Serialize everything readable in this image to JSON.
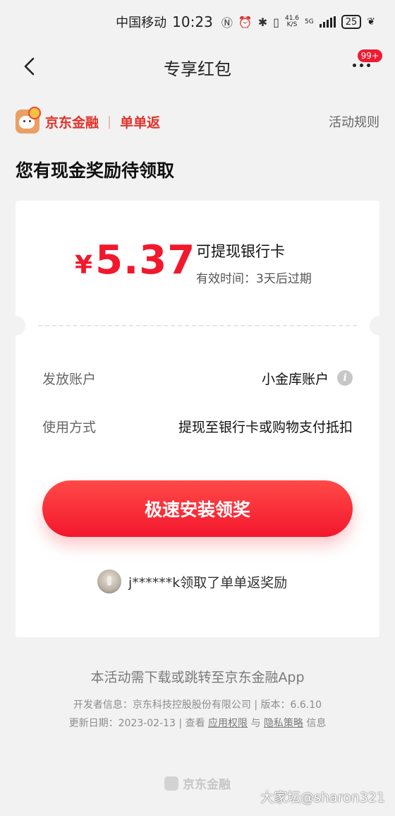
{
  "status_bar": {
    "carrier": "中国移动",
    "time": "10:23",
    "net_speed_value": "41.6",
    "net_speed_unit": "K/S",
    "network_type": "5G",
    "battery": "25",
    "icons": [
      "nfc-icon",
      "alarm-icon",
      "bluetooth-icon",
      "vibrate-icon",
      "signal-icon",
      "battery-icon",
      "leaf-icon"
    ]
  },
  "nav": {
    "title": "专享红包",
    "badge": "99+",
    "icons": [
      "back-arrow-icon",
      "more-dots-icon"
    ]
  },
  "brand": {
    "name": "京东金融",
    "separator": "|",
    "tag": "单单返",
    "rules_link": "活动规则"
  },
  "headline": "您有现金奖励待领取",
  "reward": {
    "currency": "¥",
    "amount": "5.37",
    "title": "可提现银行卡",
    "validity": "有效时间：3天后过期"
  },
  "details": [
    {
      "label": "发放账户",
      "value": "小金库账户"
    },
    {
      "label": "使用方式",
      "value": "提现至银行卡或购物支付抵扣"
    }
  ],
  "cta_label": "极速安装领奖",
  "winner_text": "j******k领取了单单返奖励",
  "footer": {
    "notice": "本活动需下载或跳转至京东金融App",
    "developer": "开发者信息：京东科技控股股份有限公司 | 版本：6.6.10",
    "update_prefix": "更新日期：2023-02-13 | 查看",
    "permissions_link": "应用权限",
    "and_text": "与",
    "privacy_link": "隐私策略",
    "info_suffix": "信息",
    "bottom_logo": "京东金融"
  },
  "watermark": "大家坛@sharon321",
  "colors": {
    "accent_red": "#f2182c",
    "brand_red": "#e4322b",
    "background": "#f2f2f2"
  }
}
